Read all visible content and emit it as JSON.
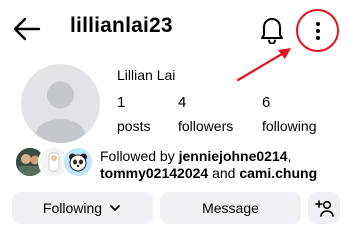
{
  "header": {
    "username": "lillianlai23",
    "back_icon": "arrow-left-icon",
    "notification_icon": "bell-icon",
    "more_icon": "more-vertical-icon"
  },
  "profile": {
    "full_name": "Lillian Lai",
    "stats": [
      {
        "value": "1",
        "label": "posts"
      },
      {
        "value": "4",
        "label": "followers"
      },
      {
        "value": "6",
        "label": "following"
      }
    ]
  },
  "followed_by": {
    "prefix": "Followed by",
    "user1": "jenniejohne0214",
    "comma": ",",
    "user2": "tommy02142024",
    "and_text": "and",
    "user3": "cami.chung"
  },
  "actions": {
    "following_label": "Following",
    "message_label": "Message",
    "add_user_icon": "add-user-icon"
  },
  "annotation": {
    "color": "#e0141e"
  }
}
